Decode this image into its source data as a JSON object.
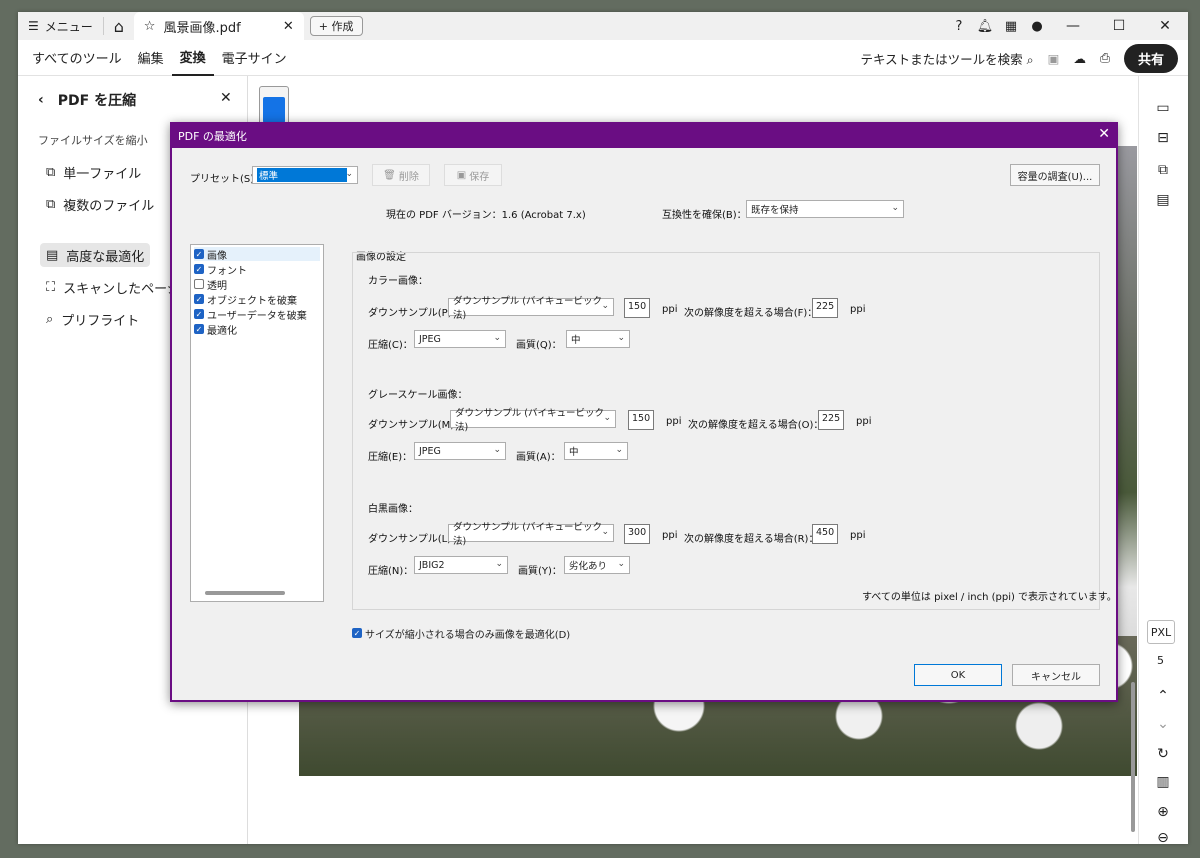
{
  "titlebar": {
    "menu_label": "メニュー",
    "tab_title": "風景画像.pdf",
    "new_label": "+ 作成",
    "minimize": "—",
    "maximize": "☐",
    "close": "✕"
  },
  "menubar": {
    "items": [
      "すべてのツール",
      "編集",
      "変換",
      "電子サイン"
    ],
    "active": "変換",
    "search_label": "テキストまたはツールを検索",
    "share_label": "共有"
  },
  "left_panel": {
    "title": "PDF を圧縮",
    "subtitle": "ファイルサイズを縮小",
    "items": [
      "単一ファイル",
      "複数のファイル",
      "高度な最適化",
      "スキャンしたページを",
      "プリフライト"
    ],
    "selected": "高度な最適化"
  },
  "right_bar": {
    "zoom_mode": "PXL",
    "page_number": "5"
  },
  "dialog": {
    "title": "PDF の最適化",
    "preset_label": "プリセット(S)：",
    "preset_value": "標準",
    "delete_label": "削除",
    "save_label": "保存",
    "audit_label": "容量の調査(U)...",
    "version_text": "現在の PDF バージョン：1.6 (Acrobat 7.x)",
    "compat_label": "互換性を確保(B)：",
    "compat_value": "既存を保持",
    "categories": [
      {
        "label": "画像",
        "checked": true
      },
      {
        "label": "フォント",
        "checked": true
      },
      {
        "label": "透明",
        "checked": false
      },
      {
        "label": "オブジェクトを破棄",
        "checked": true
      },
      {
        "label": "ユーザーデータを破棄",
        "checked": true
      },
      {
        "label": "最適化",
        "checked": true
      }
    ],
    "group_title": "画像の設定",
    "sections": [
      {
        "title": "カラー画像：",
        "downsample_label": "ダウンサンプル(P)：",
        "downsample_value": "ダウンサンプル (バイキュービック法)",
        "ppi_value": "150",
        "ppi_unit": "ppi",
        "above_label": "次の解像度を超える場合(F)：",
        "above_value": "225",
        "compression_label": "圧縮(C)：",
        "compression_value": "JPEG",
        "quality_label": "画質(Q)：",
        "quality_value": "中"
      },
      {
        "title": "グレースケール画像：",
        "downsample_label": "ダウンサンプル(M)：",
        "downsample_value": "ダウンサンプル (バイキュービック法)",
        "ppi_value": "150",
        "ppi_unit": "ppi",
        "above_label": "次の解像度を超える場合(O)：",
        "above_value": "225",
        "compression_label": "圧縮(E)：",
        "compression_value": "JPEG",
        "quality_label": "画質(A)：",
        "quality_value": "中"
      },
      {
        "title": "白黒画像：",
        "downsample_label": "ダウンサンプル(L)：",
        "downsample_value": "ダウンサンプル (バイキュービック法)",
        "ppi_value": "300",
        "ppi_unit": "ppi",
        "above_label": "次の解像度を超える場合(R)：",
        "above_value": "450",
        "compression_label": "圧縮(N)：",
        "compression_value": "JBIG2",
        "quality_label": "画質(Y)：",
        "quality_value": "劣化あり"
      }
    ],
    "units_note": "すべての単位は pixel / inch (ppi) で表示されています。",
    "optimize_only_label": "サイズが縮小される場合のみ画像を最適化(D)",
    "ok_label": "OK",
    "cancel_label": "キャンセル"
  }
}
